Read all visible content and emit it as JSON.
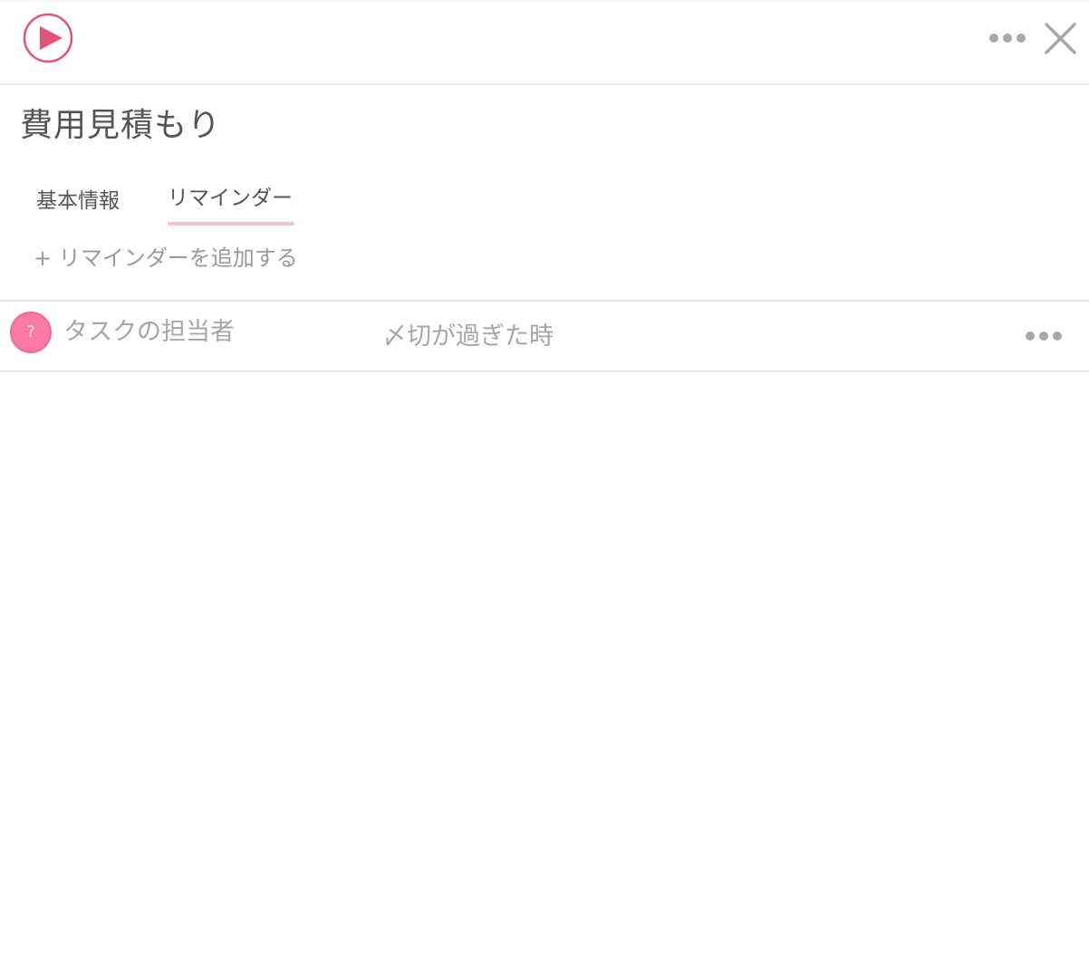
{
  "header": {
    "play_icon": "play-circle-icon",
    "more_icon": "more-horizontal-icon",
    "close_icon": "close-icon",
    "accent_color": "#e05577"
  },
  "task": {
    "title": "費用見積もり"
  },
  "tabs": [
    {
      "label": "基本情報",
      "active": false
    },
    {
      "label": "リマインダー",
      "active": true
    }
  ],
  "reminders": {
    "add_label": "+ リマインダーを追加する",
    "items": [
      {
        "avatar_text": "?",
        "assignee": "タスクの担当者",
        "trigger": "〆切が過ぎた時",
        "more_icon": "more-horizontal-icon"
      }
    ]
  }
}
